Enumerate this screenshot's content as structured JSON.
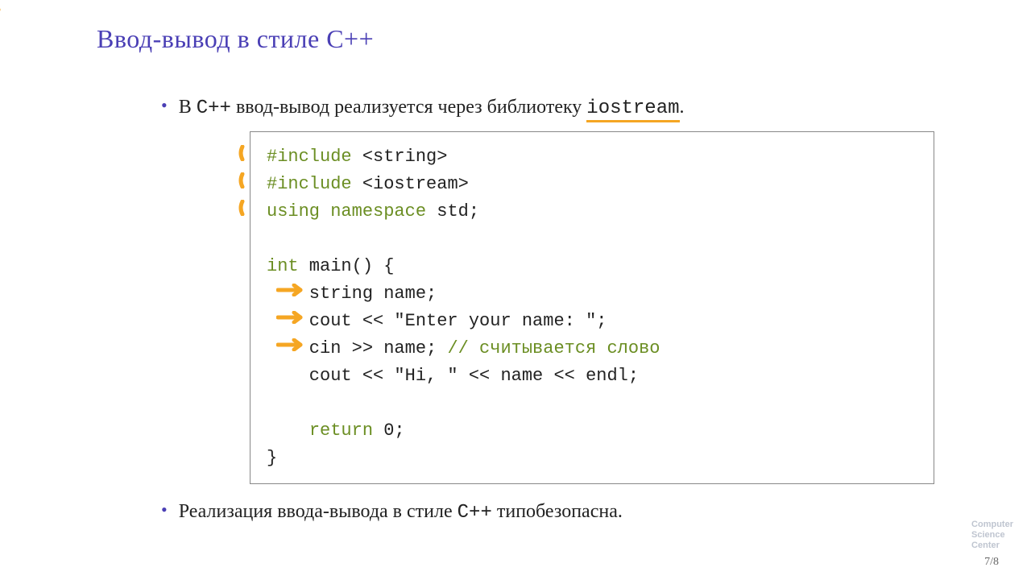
{
  "title": "Ввод-вывод в стиле C++",
  "bullet1": {
    "pre": "В ",
    "lang": "C++",
    "mid": " ввод-вывод реализуется через библиотеку ",
    "lib": "iostream",
    "post": "."
  },
  "code": {
    "l1_kw": "#include",
    "l1_rest": " <string>",
    "l2_kw": "#include",
    "l2_rest": " <iostream>",
    "l3_a": "using",
    "l3_b": "namespace",
    "l3_rest": " std;",
    "blank": "",
    "l5_a": "int",
    "l5_rest": " main() {",
    "l6": "    string name;",
    "l7": "    cout << \"Enter your name: \";",
    "l8_a": "    cin >> name; ",
    "l8_c": "// считывается слово",
    "l9": "    cout << \"Hi, \" << name << endl;",
    "l11_a": "return",
    "l11_pre": "    ",
    "l11_rest": " 0;",
    "l12": "}"
  },
  "bullet2": {
    "pre": "Реализация ввода-вывода в стиле ",
    "lang": "C++",
    "post": " типобезопасна."
  },
  "pagenum": "7/8",
  "logo": {
    "l1": "Computer",
    "l2": "Science",
    "l3": "Center"
  },
  "colors": {
    "accent": "#4a3fb5",
    "highlight": "#f5a623",
    "keyword": "#6b8e23"
  }
}
